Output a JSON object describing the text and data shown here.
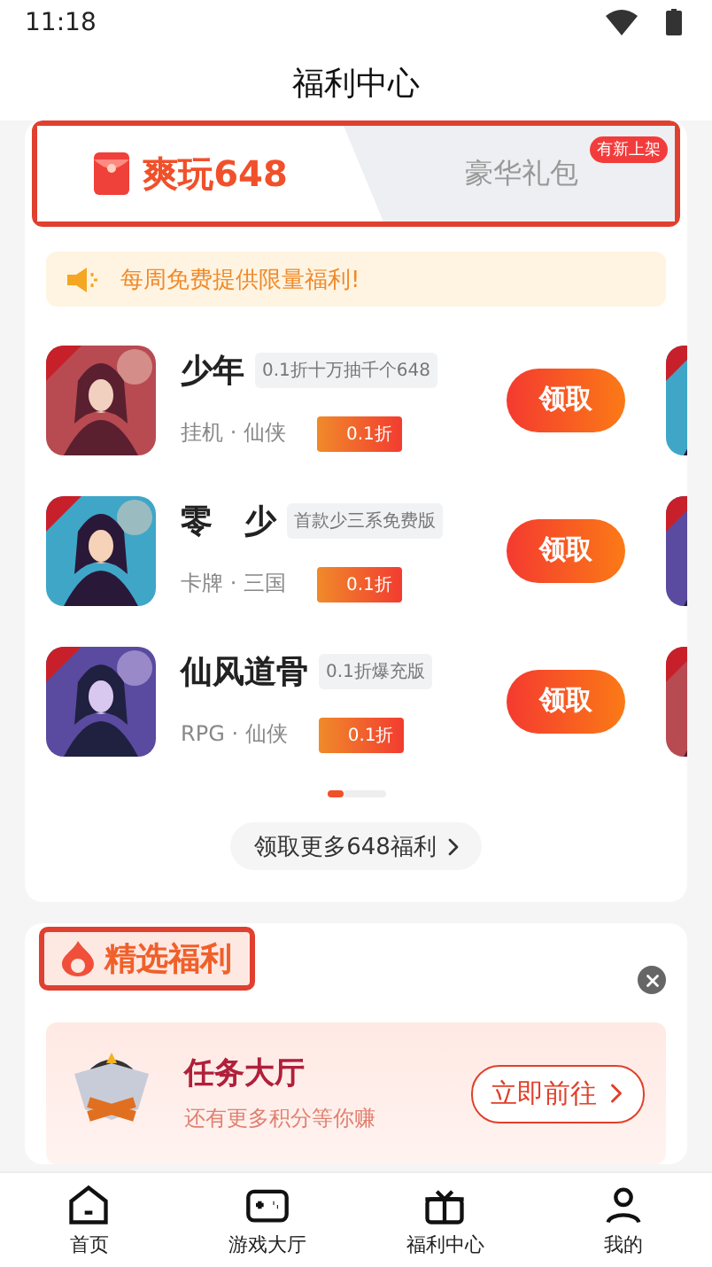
{
  "status_bar": {
    "time": "11:18"
  },
  "header": {
    "title": "福利中心"
  },
  "tabs": [
    {
      "label": "爽玩648",
      "selected": true
    },
    {
      "label": "豪华礼包",
      "selected": false,
      "badge": "有新上架"
    }
  ],
  "notice": {
    "text": "每周免费提供限量福利!"
  },
  "games": [
    {
      "name": "少年",
      "tag": "0.1折十万抽千个648",
      "genre": "挂机 · 仙侠",
      "discount": "0.1折",
      "button": "领取"
    },
    {
      "name": "零　少",
      "tag": "首款少三系免费版",
      "genre": "卡牌 · 三国",
      "discount": "0.1折",
      "button": "领取"
    },
    {
      "name": "仙风道骨",
      "tag": "0.1折爆充版",
      "genre": "RPG · 仙侠",
      "discount": "0.1折",
      "button": "领取"
    }
  ],
  "pager": [
    {
      "selected": true
    },
    {
      "selected": false
    }
  ],
  "more_button": {
    "label": "领取更多648福利"
  },
  "featured": {
    "title": "精选福利",
    "task": {
      "title": "任务大厅",
      "subtitle": "还有更多积分等你赚",
      "button": "立即前往"
    }
  },
  "nav": [
    {
      "label": "首页",
      "kind": "home"
    },
    {
      "label": "游戏大厅",
      "kind": "games"
    },
    {
      "label": "福利中心",
      "kind": "welfare"
    },
    {
      "label": "我的",
      "kind": "me"
    }
  ]
}
